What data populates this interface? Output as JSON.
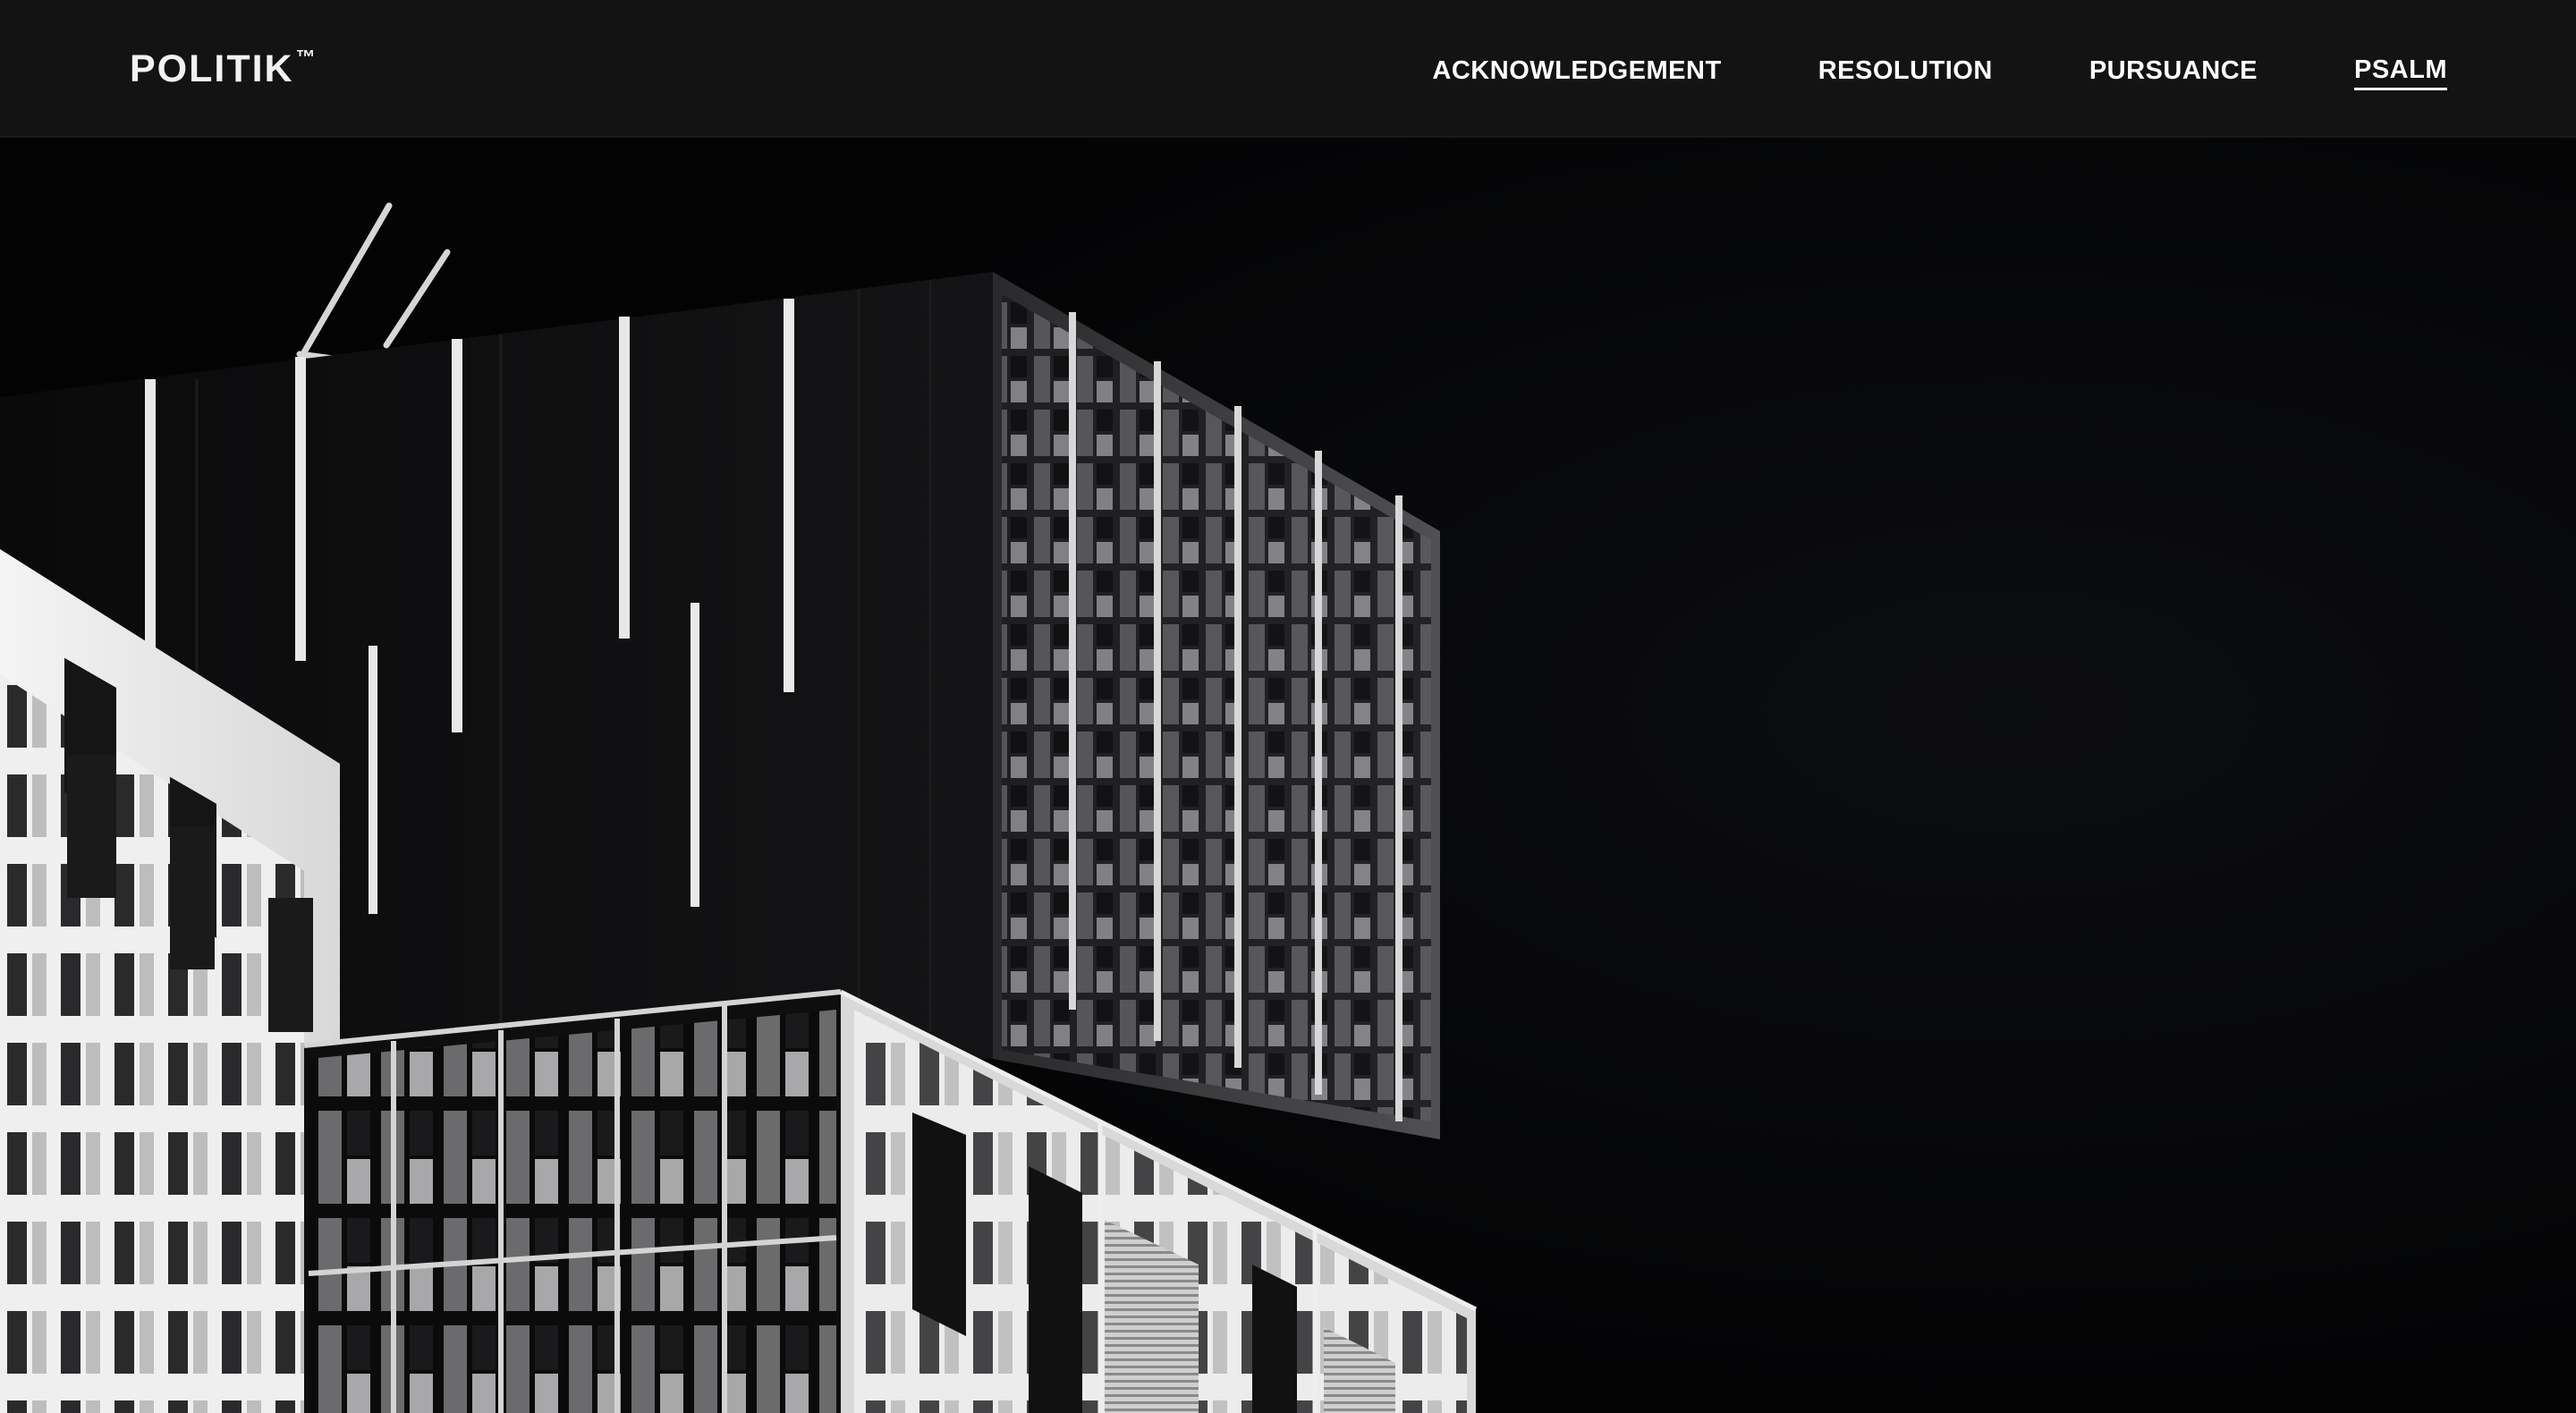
{
  "header": {
    "brand": "POLITIK",
    "brand_mark": "™",
    "nav": [
      {
        "label": "ACKNOWLEDGEMENT",
        "active": false
      },
      {
        "label": "RESOLUTION",
        "active": false
      },
      {
        "label": "PURSUANCE",
        "active": false
      },
      {
        "label": "PSALM",
        "active": true
      }
    ]
  },
  "hero": {
    "image": "black-and-white-building-photo"
  }
}
